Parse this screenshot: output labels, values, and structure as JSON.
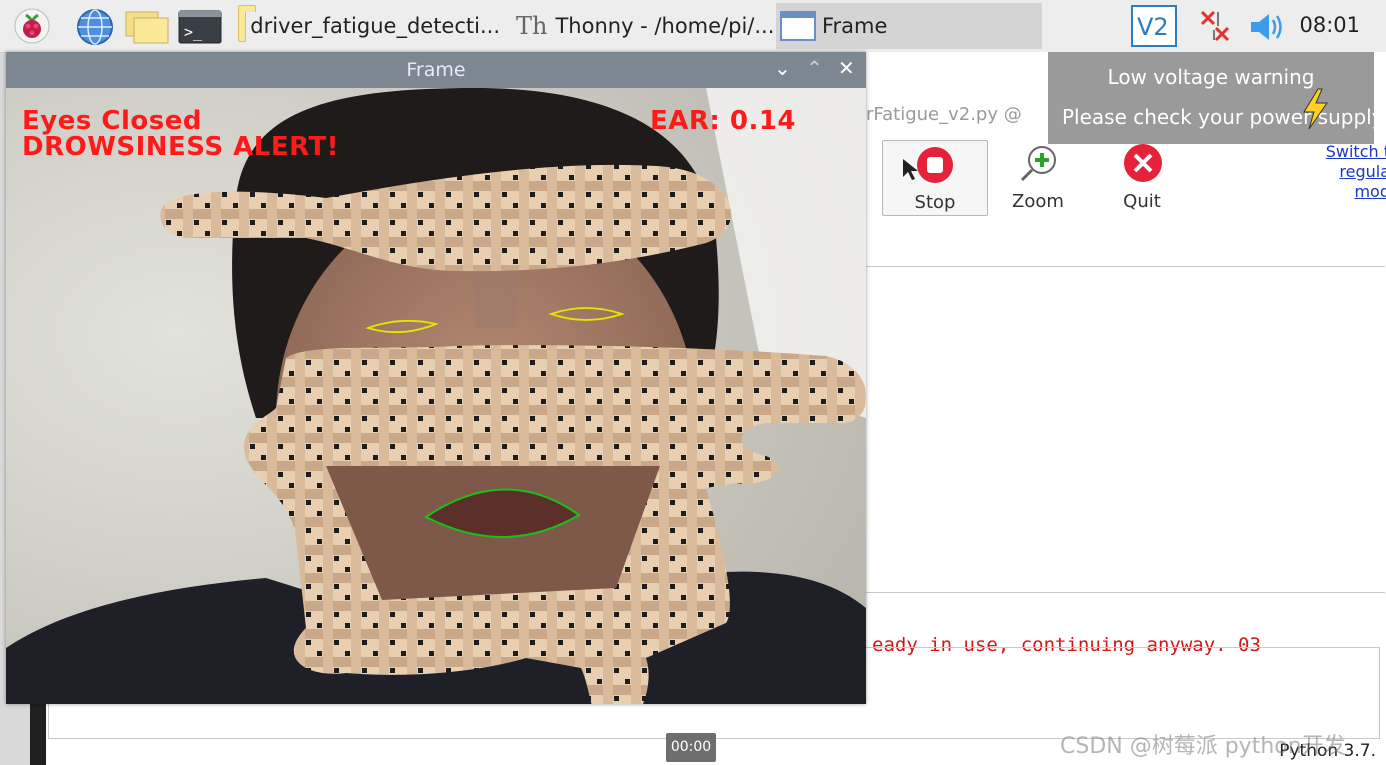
{
  "taskbar": {
    "items": [
      {
        "icon": "raspberry-icon"
      },
      {
        "icon": "globe-icon"
      },
      {
        "icon": "folders-icon"
      },
      {
        "icon": "terminal-icon"
      },
      {
        "icon": "folder-icon",
        "label": "driver_fatigue_detecti..."
      },
      {
        "icon": "thonny-icon",
        "label": "Thonny  -  /home/pi/..."
      },
      {
        "icon": "window-icon",
        "label": "Frame"
      }
    ],
    "tray": [
      "vnc-icon",
      "network-disconnected-icon",
      "volume-icon"
    ],
    "clock": "08:01"
  },
  "thonny": {
    "file_tab": "rFatigue_v2.py  @",
    "tools": [
      {
        "icon": "stop-icon",
        "label": "Stop"
      },
      {
        "icon": "zoom-icon",
        "label": "Zoom"
      },
      {
        "icon": "quit-icon",
        "label": "Quit"
      }
    ],
    "switch_link": [
      "Switch t",
      "regula",
      "mod"
    ],
    "shell_text": "eady in use, continuing anyway.  03",
    "python_version": "Python 3.7."
  },
  "notification": {
    "title": "Low voltage warning",
    "body": "Please check your power supply"
  },
  "frame_window": {
    "title": "Frame",
    "controls": [
      "⌄",
      "⌃",
      "✕"
    ],
    "overlay": {
      "status": "Eyes Closed",
      "alert": "DROWSINESS ALERT!",
      "ear": "EAR: 0.14"
    }
  },
  "video_time": "00:00",
  "watermark": "CSDN @树莓派 python开发",
  "colors": {
    "alert_red": "#ff1a1a",
    "eye_contour": "#e6e600",
    "mouth_contour": "#19c219",
    "title_bar": "#7d8792",
    "link_blue": "#1a37c8"
  }
}
